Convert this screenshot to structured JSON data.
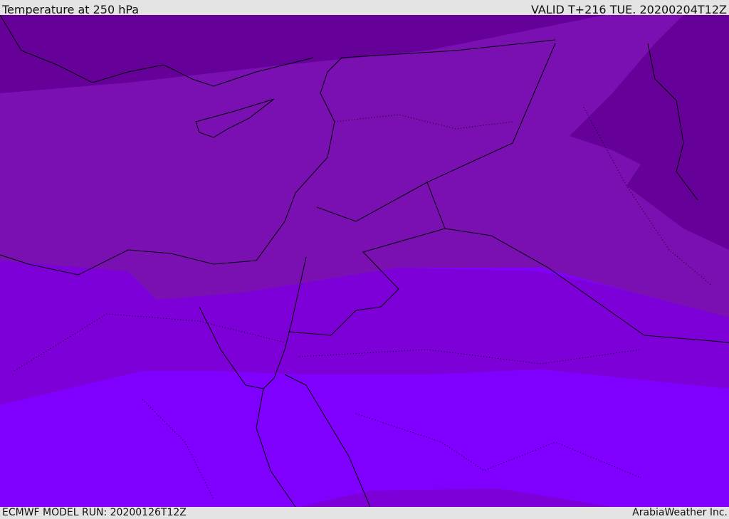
{
  "header": {
    "title": "Temperature at 250 hPa",
    "valid": "VALID T+216 TUE. 20200204T12Z"
  },
  "footer": {
    "model_run": "ECMWF MODEL RUN: 20200126T12Z",
    "credit": "ArabiaWeather Inc."
  },
  "colors": {
    "band1": "#650098",
    "band2": "#7a10b2",
    "band3": "#7e00d8",
    "band4": "#8000ff",
    "coast": "#000000"
  }
}
